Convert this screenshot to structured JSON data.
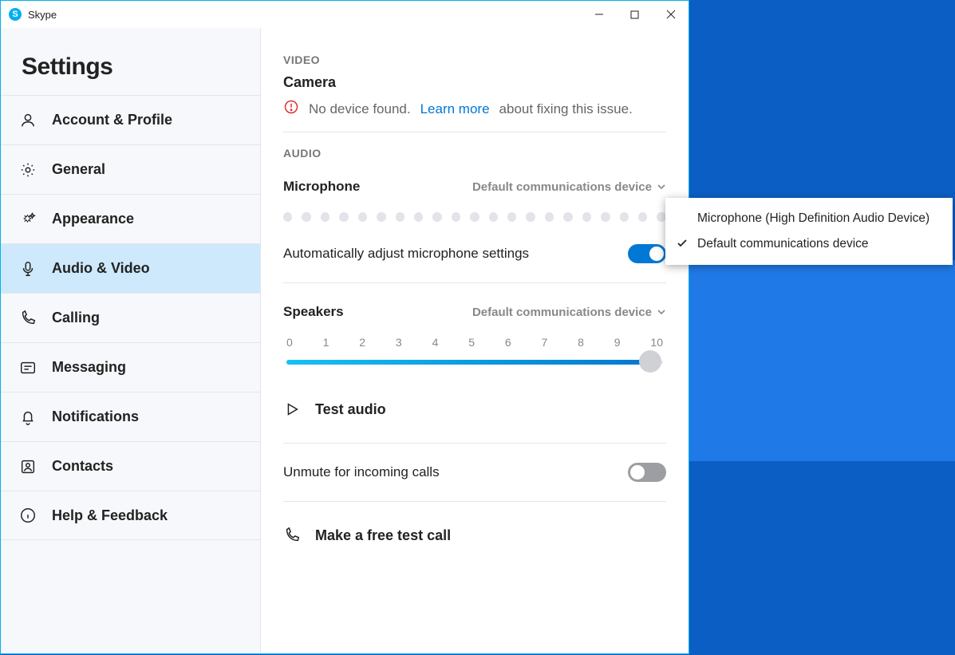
{
  "window": {
    "title": "Skype"
  },
  "sidebar": {
    "heading": "Settings",
    "items": [
      {
        "label": "Account & Profile"
      },
      {
        "label": "General"
      },
      {
        "label": "Appearance"
      },
      {
        "label": "Audio & Video"
      },
      {
        "label": "Calling"
      },
      {
        "label": "Messaging"
      },
      {
        "label": "Notifications"
      },
      {
        "label": "Contacts"
      },
      {
        "label": "Help & Feedback"
      }
    ],
    "active_index": 3
  },
  "video": {
    "section": "VIDEO",
    "camera_label": "Camera",
    "no_device_pre": "No device found.",
    "learn_more": "Learn more",
    "no_device_post": "about fixing this issue."
  },
  "audio": {
    "section": "AUDIO",
    "microphone_label": "Microphone",
    "microphone_selector": "Default communications device",
    "auto_adjust_label": "Automatically adjust microphone settings",
    "auto_adjust_on": true,
    "speakers_label": "Speakers",
    "speakers_selector": "Default communications device",
    "speakers_value": 10,
    "speakers_ticks": [
      "0",
      "1",
      "2",
      "3",
      "4",
      "5",
      "6",
      "7",
      "8",
      "9",
      "10"
    ],
    "test_audio": "Test audio",
    "unmute_label": "Unmute for incoming calls",
    "unmute_on": false,
    "test_call": "Make a free test call"
  },
  "mic_dropdown": {
    "items": [
      {
        "label": "Microphone (High Definition Audio Device)",
        "selected": false
      },
      {
        "label": "Default communications device",
        "selected": true
      }
    ]
  }
}
